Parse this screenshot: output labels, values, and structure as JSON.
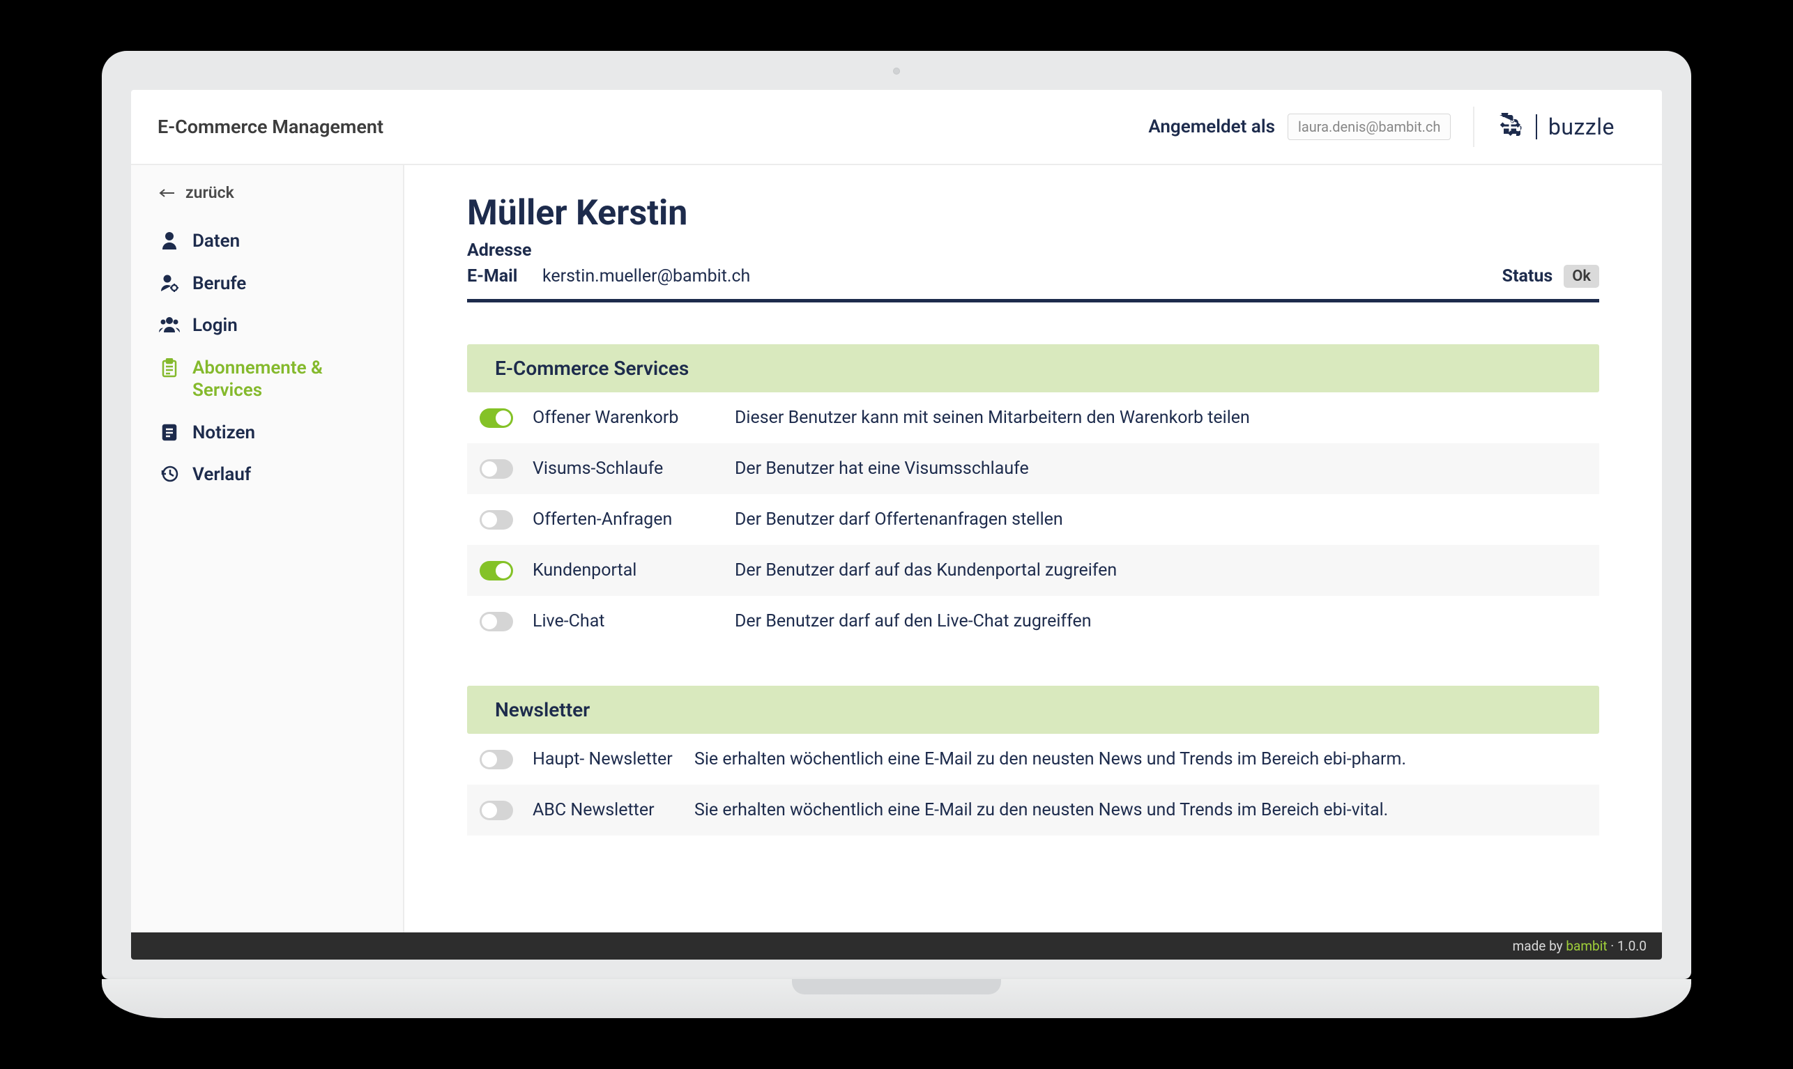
{
  "header": {
    "title": "E-Commerce Management",
    "logged_in_label": "Angemeldet als",
    "logged_in_email": "laura.denis@bambit.ch",
    "logo_text": "buzzle"
  },
  "sidebar": {
    "back_label": "zurück",
    "items": [
      {
        "icon": "user",
        "label": "Daten",
        "active": false
      },
      {
        "icon": "user-gear",
        "label": "Berufe",
        "active": false
      },
      {
        "icon": "users",
        "label": "Login",
        "active": false
      },
      {
        "icon": "clipboard",
        "label": "Abonnemente & Services",
        "active": true
      },
      {
        "icon": "note",
        "label": "Notizen",
        "active": false
      },
      {
        "icon": "history",
        "label": "Verlauf",
        "active": false
      }
    ]
  },
  "user": {
    "name": "Müller Kerstin",
    "address_label": "Adresse",
    "email_label": "E-Mail",
    "email_value": "kerstin.mueller@bambit.ch",
    "status_label": "Status",
    "status_value": "Ok"
  },
  "sections": {
    "ecommerce": {
      "title": "E-Commerce Services",
      "rows": [
        {
          "on": true,
          "name": "Offener Warenkorb",
          "desc": "Dieser Benutzer kann mit seinen Mitarbeitern den Warenkorb teilen"
        },
        {
          "on": false,
          "name": "Visums-Schlaufe",
          "desc": "Der Benutzer hat eine Visumsschlaufe"
        },
        {
          "on": false,
          "name": "Offerten-Anfragen",
          "desc": "Der Benutzer darf Offertenanfragen stellen"
        },
        {
          "on": true,
          "name": "Kundenportal",
          "desc": "Der Benutzer darf auf das Kundenportal zugreifen"
        },
        {
          "on": false,
          "name": "Live-Chat",
          "desc": "Der Benutzer darf auf den Live-Chat zugreiffen"
        }
      ]
    },
    "newsletter": {
      "title": "Newsletter",
      "rows": [
        {
          "on": false,
          "name": "Haupt- Newsletter",
          "desc": "Sie erhalten wöchentlich eine E-Mail zu den neusten News und Trends im Bereich ebi-pharm."
        },
        {
          "on": false,
          "name": "ABC Newsletter",
          "desc": "Sie erhalten wöchentlich eine E-Mail zu den neusten News und Trends im Bereich ebi-vital."
        }
      ]
    }
  },
  "footer": {
    "prefix": "made by ",
    "brand": "bambit",
    "suffix": " · 1.0.0"
  }
}
